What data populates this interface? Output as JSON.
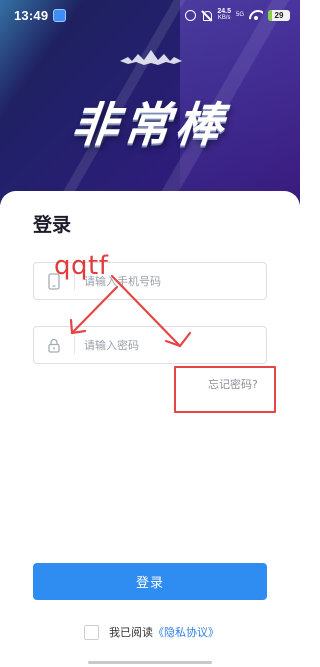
{
  "status_bar": {
    "time": "13:49",
    "speed_value": "24.5",
    "speed_unit": "KB/s",
    "network": "5G",
    "battery": "29"
  },
  "brand": {
    "title": "非常棒"
  },
  "login": {
    "heading": "登录",
    "phone_placeholder": "请输入手机号码",
    "password_placeholder": "请输入密码",
    "forgot_label": "忘记密码?",
    "submit_label": "登录"
  },
  "agreement": {
    "prefix": "我已阅读",
    "link_label": "《隐私协议》"
  },
  "annotation": {
    "text": "qqtf",
    "color": "#e23b3b"
  },
  "colors": {
    "accent": "#2f8df2",
    "header_dark": "#22206a",
    "annotation_red": "#e44545"
  },
  "icons": {
    "phone_field": "phone-icon",
    "password_field": "lock-icon",
    "brand_ornament": "crown-ornament-icon"
  }
}
